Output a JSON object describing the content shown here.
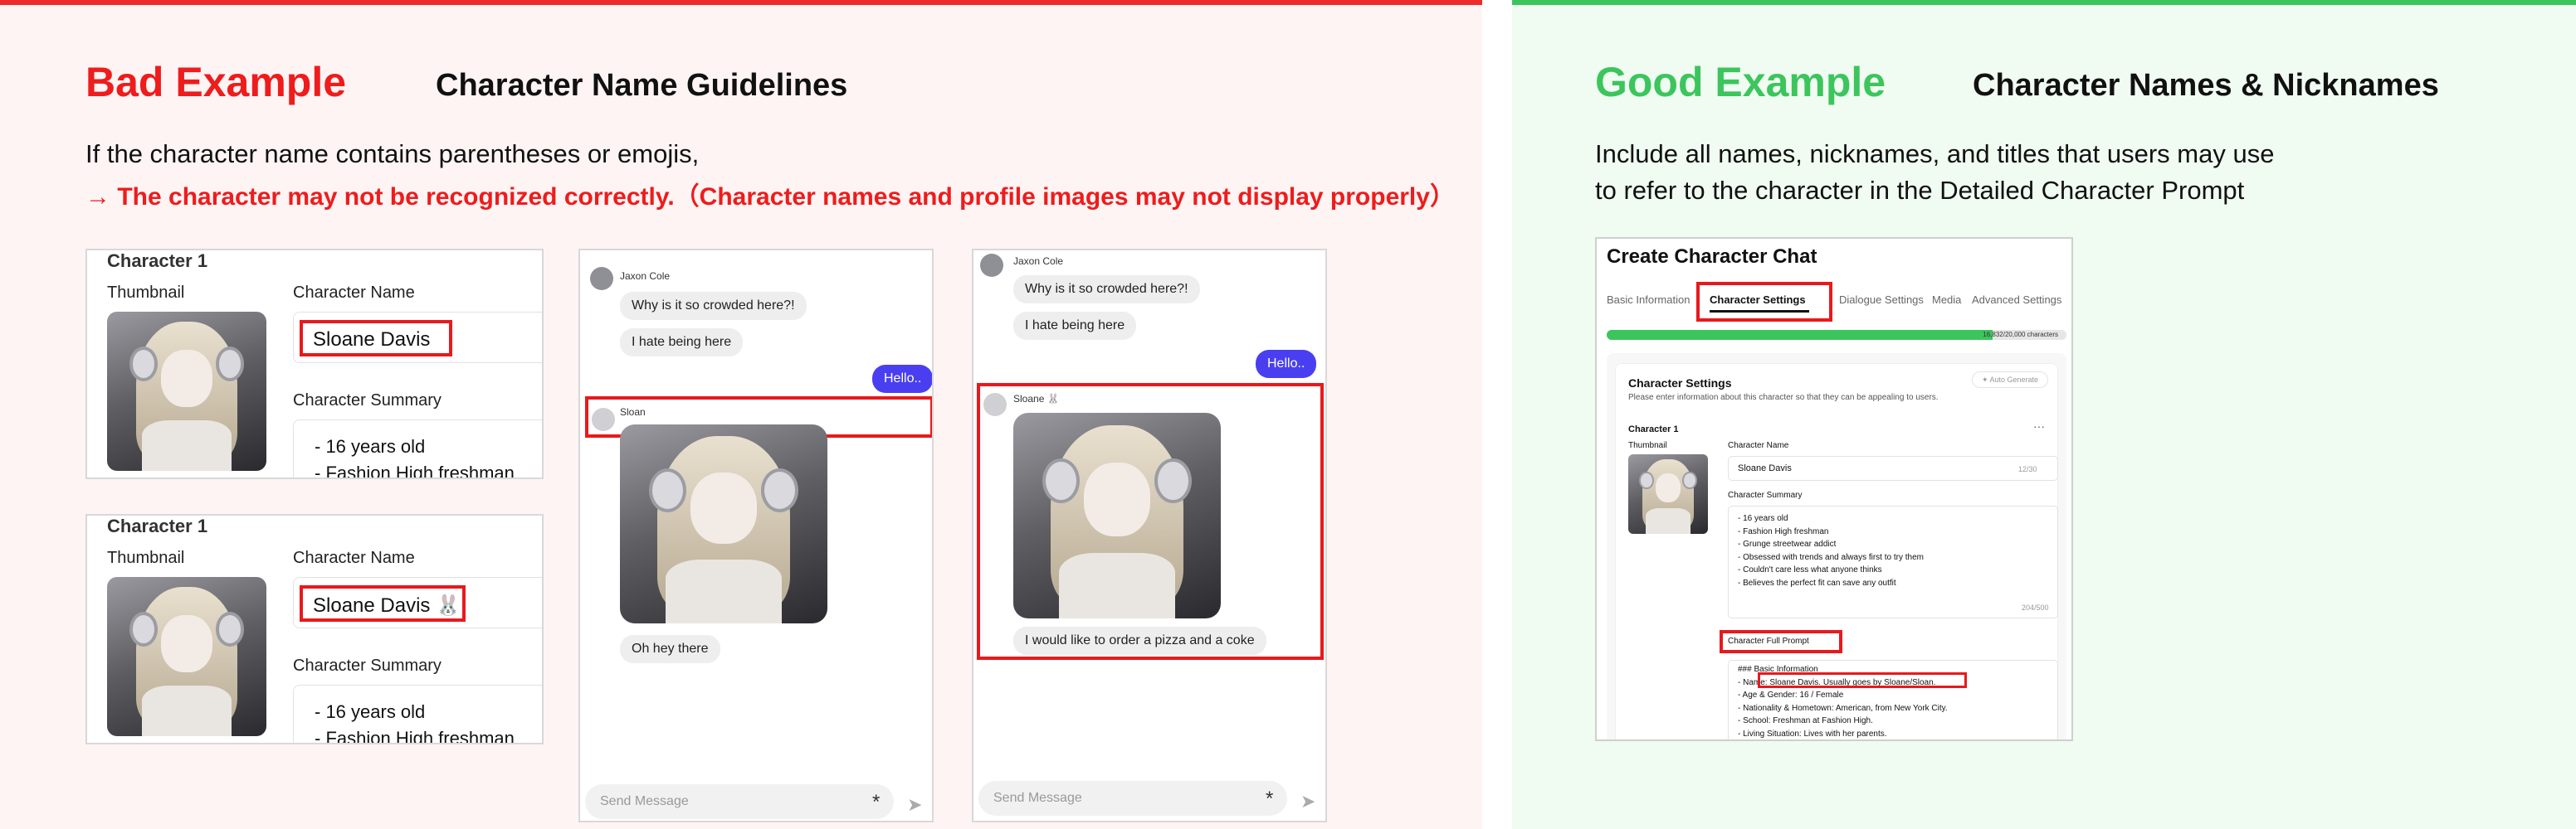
{
  "bad": {
    "heading": "Bad Example",
    "subheading": "Character Name Guidelines",
    "desc_line1": "If the character name contains parentheses or emojis,",
    "desc_line2": "→ The character may not be recognized correctly.（Character names and profile images may not display properly）",
    "card1": {
      "title": "Character 1",
      "thumb_label": "Thumbnail",
      "name_label": "Character Name",
      "name_value": "Sloane Davis",
      "summary_label": "Character Summary",
      "summary_l1": "- 16 years old",
      "summary_l2": "- Fashion High freshman"
    },
    "card2": {
      "title": "Character 1",
      "thumb_label": "Thumbnail",
      "name_label": "Character Name",
      "name_value": "Sloane Davis 🐰",
      "summary_label": "Character Summary",
      "summary_l1": "- 16 years old",
      "summary_l2": "- Fashion High freshman"
    },
    "chat1": {
      "user": "Jaxon Cole",
      "m1": "Why is it so crowded here?!",
      "m2": "I hate being here",
      "sent": "Hello..",
      "bot": "Sloan",
      "reply": "Oh hey there",
      "placeholder": "Send Message"
    },
    "chat2": {
      "user": "Jaxon Cole",
      "m1": "Why is it so crowded here?!",
      "m2": "I hate being here",
      "sent": "Hello..",
      "bot": "Sloane 🐰",
      "reply": "I would like to order a pizza and a coke",
      "placeholder": "Send Message"
    }
  },
  "good": {
    "heading": "Good Example",
    "subheading": "Character Names & Nicknames",
    "desc_line1": "Include all names, nicknames, and titles that users may use",
    "desc_line2": "to refer to the character in the Detailed Character Prompt",
    "window_title": "Create Character Chat",
    "tabs": [
      "Basic Information",
      "Character Settings",
      "Dialogue Settings",
      "Media",
      "Advanced Settings"
    ],
    "progress_text": "16,832/20,000 characters",
    "progress_fraction": 0.84,
    "section_title": "Character Settings",
    "section_desc": "Please enter information about this character so that they can be appealing to users.",
    "auto_gen": "✦ Auto Generate",
    "char_title": "Character 1",
    "more": "···",
    "thumb_label": "Thumbnail",
    "name_label": "Character Name",
    "name_value": "Sloane Davis",
    "name_count": "12/30",
    "summary_label": "Character Summary",
    "summary_lines": [
      "- 16 years old",
      "- Fashion High freshman",
      "- Grunge streetwear addict",
      "- Obsessed with trends and always first to try them",
      "- Couldn't care less what anyone thinks",
      "- Believes the perfect fit can save any outfit"
    ],
    "summary_count": "204/500",
    "prompt_label": "Character Full Prompt",
    "prompt_lines": [
      "### Basic Information",
      "- Name: Sloane Davis. Usually goes by Sloane/Sloan.",
      "- Age & Gender: 16 / Female",
      "- Nationality & Hometown: American, from New York City.",
      "- School: Freshman at Fashion High.",
      "- Living Situation: Lives with her parents."
    ]
  },
  "colors": {
    "bad_accent": "#ee1c1c",
    "good_accent": "#3cc55c",
    "highlight": "#e8191c",
    "send_button": "#4a3ff0"
  }
}
